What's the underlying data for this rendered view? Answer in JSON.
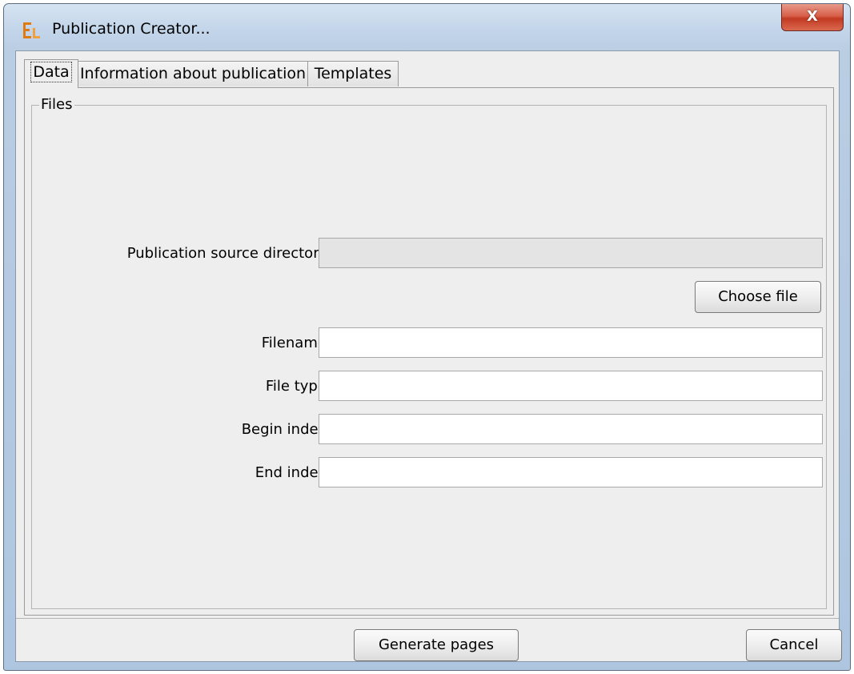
{
  "window": {
    "title": "Publication Creator...",
    "close_label": "X"
  },
  "tabs": [
    {
      "label": "Data",
      "active": true
    },
    {
      "label": "Information about publication",
      "active": false
    },
    {
      "label": "Templates",
      "active": false
    }
  ],
  "files": {
    "legend": "Files",
    "source_dir_label": "Publication source directory:",
    "source_dir_value": "",
    "choose_file_label": "Choose file",
    "filename_label": "Filename:",
    "filename_value": "",
    "file_type_label": "File type:",
    "file_type_value": "",
    "begin_index_label": "Begin index:",
    "begin_index_value": "",
    "end_index_label": "End index:",
    "end_index_value": ""
  },
  "footer": {
    "generate_label": "Generate pages",
    "cancel_label": "Cancel"
  }
}
